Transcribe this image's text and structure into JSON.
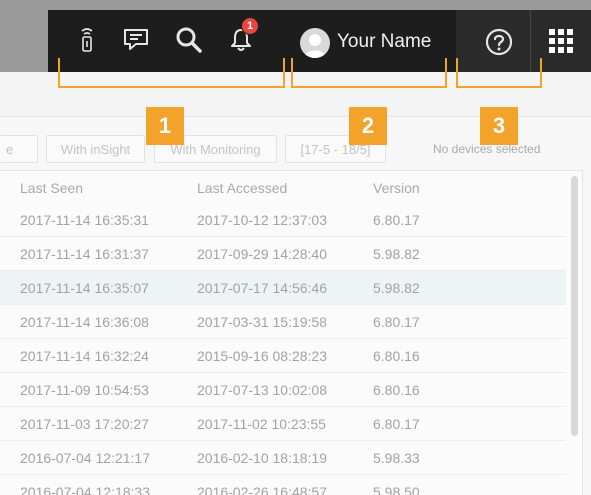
{
  "header": {
    "notification_count": "1",
    "user_name": "Your Name",
    "icons": [
      "remote-icon",
      "chat-icon",
      "search-icon",
      "bell-icon",
      "user-avatar-icon",
      "help-icon",
      "apps-grid-icon"
    ]
  },
  "callouts": [
    "1",
    "2",
    "3"
  ],
  "filters": {
    "partial": "e",
    "with_insight": "With inSight",
    "with_monitoring": "With Monitoring",
    "range": "[17-5 - 18/5]",
    "selection_status": "No devices selected"
  },
  "table": {
    "columns": [
      "Last Seen",
      "Last Accessed",
      "Version"
    ],
    "rows": [
      [
        "2017-11-14 16:35:31",
        "2017-10-12 12:37:03",
        "6.80.17"
      ],
      [
        "2017-11-14 16:31:37",
        "2017-09-29 14:28:40",
        "5.98.82"
      ],
      [
        "2017-11-14 16:35:07",
        "2017-07-17 14:56:46",
        "5.98.82"
      ],
      [
        "2017-11-14 16:36:08",
        "2017-03-31 15:19:58",
        "6.80.17"
      ],
      [
        "2017-11-14 16:32:24",
        "2015-09-16 08:28:23",
        "6.80.16"
      ],
      [
        "2017-11-09 10:54:53",
        "2017-07-13 10:02:08",
        "6.80.16"
      ],
      [
        "2017-11-03 17:20:27",
        "2017-11-02 10:23:55",
        "6.80.17"
      ],
      [
        "2016-07-04 12:21:17",
        "2016-02-10 18:18:19",
        "5.98.33"
      ],
      [
        "2016-07-04 12:18:33",
        "2016-02-26 16:48:57",
        "5.98.50"
      ]
    ]
  },
  "colors": {
    "accent": "#f3a32a",
    "badge": "#e8453c",
    "topbar": "#1d1d1d"
  }
}
